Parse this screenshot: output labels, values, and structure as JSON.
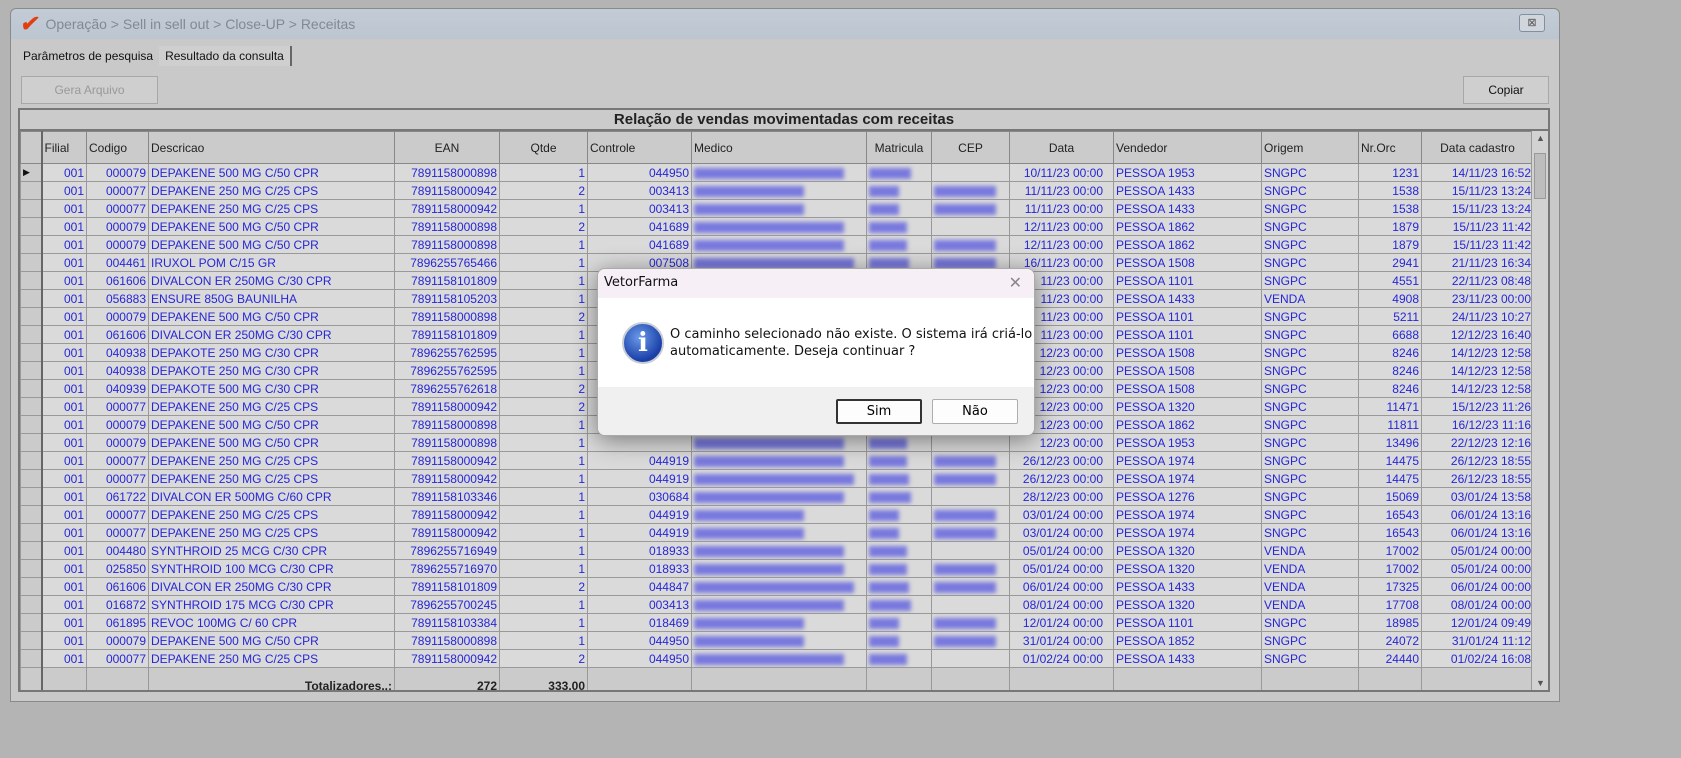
{
  "window": {
    "title": "Operação > Sell in sell out > Close-UP > Receitas",
    "close_label": "⊠"
  },
  "tabs": [
    {
      "label": "Parâmetros de pesquisa"
    },
    {
      "label": "Resultado da consulta"
    }
  ],
  "toolbar": {
    "gera_arquivo": "Gera Arquivo",
    "copiar": "Copiar"
  },
  "grid": {
    "caption": "Relação de vendas movimentadas com receitas",
    "columns": [
      "Filial",
      "Codigo",
      "Descricao",
      "EAN",
      "Qtde",
      "Controle",
      "Medico",
      "Matricula",
      "CEP",
      "Data",
      "Vendedor",
      "Origem",
      "Nr.Orc",
      "Data cadastro"
    ],
    "rows": [
      [
        "001",
        "000079",
        "DEPAKENE 500 MG C/50 CPR",
        "7891158000898",
        "1",
        "044950",
        "10/11/23 00:00",
        "PESSOA 1953",
        "SNGPC",
        "1231",
        "14/11/23 16:52"
      ],
      [
        "001",
        "000077",
        "DEPAKENE 250 MG C/25 CPS",
        "7891158000942",
        "2",
        "003413",
        "11/11/23 00:00",
        "PESSOA 1433",
        "SNGPC",
        "1538",
        "15/11/23 13:24"
      ],
      [
        "001",
        "000077",
        "DEPAKENE 250 MG C/25 CPS",
        "7891158000942",
        "1",
        "003413",
        "11/11/23 00:00",
        "PESSOA 1433",
        "SNGPC",
        "1538",
        "15/11/23 13:24"
      ],
      [
        "001",
        "000079",
        "DEPAKENE 500 MG C/50 CPR",
        "7891158000898",
        "2",
        "041689",
        "12/11/23 00:00",
        "PESSOA 1862",
        "SNGPC",
        "1879",
        "15/11/23 11:42"
      ],
      [
        "001",
        "000079",
        "DEPAKENE 500 MG C/50 CPR",
        "7891158000898",
        "1",
        "041689",
        "12/11/23 00:00",
        "PESSOA 1862",
        "SNGPC",
        "1879",
        "15/11/23 11:42"
      ],
      [
        "001",
        "004461",
        "IRUXOL POM C/15 GR",
        "7896255765466",
        "1",
        "007508",
        "16/11/23 00:00",
        "PESSOA 1508",
        "SNGPC",
        "2941",
        "21/11/23 16:34"
      ],
      [
        "001",
        "061606",
        "DIVALCON ER 250MG C/30 CPR",
        "7891158101809",
        "1",
        "",
        "11/23 00:00",
        "PESSOA 1101",
        "SNGPC",
        "4551",
        "22/11/23 08:48"
      ],
      [
        "001",
        "056883",
        "ENSURE 850G BAUNILHA",
        "7891158105203",
        "1",
        "",
        "11/23 00:00",
        "PESSOA 1433",
        "VENDA",
        "4908",
        "23/11/23 00:00"
      ],
      [
        "001",
        "000079",
        "DEPAKENE 500 MG C/50 CPR",
        "7891158000898",
        "2",
        "",
        "11/23 00:00",
        "PESSOA 1101",
        "SNGPC",
        "5211",
        "24/11/23 10:27"
      ],
      [
        "001",
        "061606",
        "DIVALCON ER 250MG C/30 CPR",
        "7891158101809",
        "1",
        "",
        "11/23 00:00",
        "PESSOA 1101",
        "SNGPC",
        "6688",
        "12/12/23 16:40"
      ],
      [
        "001",
        "040938",
        "DEPAKOTE 250 MG C/30 CPR",
        "7896255762595",
        "1",
        "",
        "12/23 00:00",
        "PESSOA 1508",
        "SNGPC",
        "8246",
        "14/12/23 12:58"
      ],
      [
        "001",
        "040938",
        "DEPAKOTE 250 MG C/30 CPR",
        "7896255762595",
        "1",
        "",
        "12/23 00:00",
        "PESSOA 1508",
        "SNGPC",
        "8246",
        "14/12/23 12:58"
      ],
      [
        "001",
        "040939",
        "DEPAKOTE 500 MG C/30 CPR",
        "7896255762618",
        "2",
        "",
        "12/23 00:00",
        "PESSOA 1508",
        "SNGPC",
        "8246",
        "14/12/23 12:58"
      ],
      [
        "001",
        "000077",
        "DEPAKENE 250 MG C/25 CPS",
        "7891158000942",
        "2",
        "",
        "12/23 00:00",
        "PESSOA 1320",
        "SNGPC",
        "11471",
        "15/12/23 11:26"
      ],
      [
        "001",
        "000079",
        "DEPAKENE 500 MG C/50 CPR",
        "7891158000898",
        "1",
        "",
        "12/23 00:00",
        "PESSOA 1862",
        "SNGPC",
        "11811",
        "16/12/23 11:16"
      ],
      [
        "001",
        "000079",
        "DEPAKENE 500 MG C/50 CPR",
        "7891158000898",
        "1",
        "",
        "12/23 00:00",
        "PESSOA 1953",
        "SNGPC",
        "13496",
        "22/12/23 12:16"
      ],
      [
        "001",
        "000077",
        "DEPAKENE 250 MG C/25 CPS",
        "7891158000942",
        "1",
        "044919",
        "26/12/23 00:00",
        "PESSOA 1974",
        "SNGPC",
        "14475",
        "26/12/23 18:55"
      ],
      [
        "001",
        "000077",
        "DEPAKENE 250 MG C/25 CPS",
        "7891158000942",
        "1",
        "044919",
        "26/12/23 00:00",
        "PESSOA 1974",
        "SNGPC",
        "14475",
        "26/12/23 18:55"
      ],
      [
        "001",
        "061722",
        "DIVALCON ER 500MG C/60 CPR",
        "7891158103346",
        "1",
        "030684",
        "28/12/23 00:00",
        "PESSOA 1276",
        "SNGPC",
        "15069",
        "03/01/24 13:58"
      ],
      [
        "001",
        "000077",
        "DEPAKENE 250 MG C/25 CPS",
        "7891158000942",
        "1",
        "044919",
        "03/01/24 00:00",
        "PESSOA 1974",
        "SNGPC",
        "16543",
        "06/01/24 13:16"
      ],
      [
        "001",
        "000077",
        "DEPAKENE 250 MG C/25 CPS",
        "7891158000942",
        "1",
        "044919",
        "03/01/24 00:00",
        "PESSOA 1974",
        "SNGPC",
        "16543",
        "06/01/24 13:16"
      ],
      [
        "001",
        "004480",
        "SYNTHROID 25 MCG C/30 CPR",
        "7896255716949",
        "1",
        "018933",
        "05/01/24 00:00",
        "PESSOA 1320",
        "VENDA",
        "17002",
        "05/01/24 00:00"
      ],
      [
        "001",
        "025850",
        "SYNTHROID 100 MCG C/30 CPR",
        "7896255716970",
        "1",
        "018933",
        "05/01/24 00:00",
        "PESSOA 1320",
        "VENDA",
        "17002",
        "05/01/24 00:00"
      ],
      [
        "001",
        "061606",
        "DIVALCON ER 250MG C/30 CPR",
        "7891158101809",
        "2",
        "044847",
        "06/01/24 00:00",
        "PESSOA 1433",
        "VENDA",
        "17325",
        "06/01/24 00:00"
      ],
      [
        "001",
        "016872",
        "SYNTHROID 175 MCG C/30 CPR",
        "7896255700245",
        "1",
        "003413",
        "08/01/24 00:00",
        "PESSOA 1320",
        "VENDA",
        "17708",
        "08/01/24 00:00"
      ],
      [
        "001",
        "061895",
        "REVOC 100MG C/ 60 CPR",
        "7891158103384",
        "1",
        "018469",
        "12/01/24 00:00",
        "PESSOA 1101",
        "SNGPC",
        "18985",
        "12/01/24 09:49"
      ],
      [
        "001",
        "000079",
        "DEPAKENE 500 MG C/50 CPR",
        "7891158000898",
        "1",
        "044950",
        "31/01/24 00:00",
        "PESSOA 1852",
        "SNGPC",
        "24072",
        "31/01/24 11:12"
      ],
      [
        "001",
        "000077",
        "DEPAKENE 250 MG C/25 CPS",
        "7891158000942",
        "2",
        "044950",
        "01/02/24 00:00",
        "PESSOA 1433",
        "SNGPC",
        "24440",
        "01/02/24 16:08"
      ]
    ],
    "footer": {
      "label": "Totalizadores..:",
      "ean_total": "272",
      "qtde_total": "333,00"
    }
  },
  "dialog": {
    "title": "VetorFarma",
    "message": "O caminho selecionado não existe. O sistema irá criá-lo automaticamente. Deseja continuar ?",
    "yes": "Sim",
    "no": "Não",
    "icon": "info-icon"
  }
}
